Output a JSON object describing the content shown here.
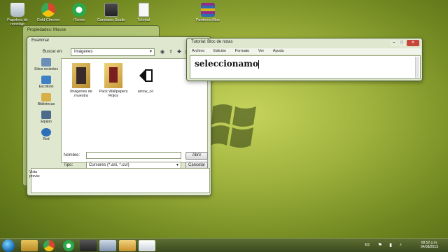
{
  "desktop": {
    "icons": [
      {
        "label": "Papelera de reciclaje",
        "icon": "recycle-bin-icon"
      },
      {
        "label": "Gold Chrome",
        "icon": "chrome-icon"
      },
      {
        "label": "iTunes",
        "icon": "itunes-icon"
      },
      {
        "label": "Camtasia Studio",
        "icon": "camtasia-icon"
      },
      {
        "label": "Tutorial",
        "icon": "text-file-icon"
      },
      {
        "label": "Punteros Blue",
        "icon": "winrar-icon"
      }
    ]
  },
  "mouse_window": {
    "title": "Propiedades: Mouse"
  },
  "browse_dialog": {
    "title": "Examinar",
    "look_in_label": "Buscar en:",
    "look_in_value": "Imágenes",
    "places": [
      {
        "label": "Sitios recientes",
        "icon": "recent-places-icon"
      },
      {
        "label": "Escritorio",
        "icon": "desktop-icon"
      },
      {
        "label": "Bibliotecas",
        "icon": "libraries-icon"
      },
      {
        "label": "Equipo",
        "icon": "computer-icon"
      },
      {
        "label": "Red",
        "icon": "network-icon"
      }
    ],
    "files": [
      {
        "label": "Imágenes de muestra",
        "icon": "folder-icon"
      },
      {
        "label": "Pack Wallpapers Rojos",
        "icon": "folder-icon"
      },
      {
        "label": "arrow_co",
        "icon": "cursor-file-icon"
      }
    ],
    "name_label": "Nombre:",
    "name_value": "",
    "type_label": "Tipo:",
    "type_value": "Cursores (*.ani, *.cur)",
    "open_button": "Abrir",
    "cancel_button": "Cancelar",
    "preview_label": "Vista previa:"
  },
  "notepad": {
    "title": "Tutorial: Bloc de notas",
    "menu": [
      "Archivo",
      "Edición",
      "Formato",
      "Ver",
      "Ayuda"
    ],
    "text": "seleccionamo"
  },
  "taskbar": {
    "items": [
      {
        "icon": "explorer-icon"
      },
      {
        "icon": "chrome-icon"
      },
      {
        "icon": "itunes-icon"
      },
      {
        "icon": "camtasia-icon"
      },
      {
        "icon": "mouse-properties-icon"
      },
      {
        "icon": "media-player-icon"
      },
      {
        "icon": "notepad-icon"
      }
    ],
    "language": "ES",
    "time": "08:52 p.m.",
    "date": "04/08/2013"
  },
  "colors": {
    "desktop_green": "#9fb23d",
    "window_frame": "#dfe7ce",
    "close_red": "#c7463a"
  }
}
